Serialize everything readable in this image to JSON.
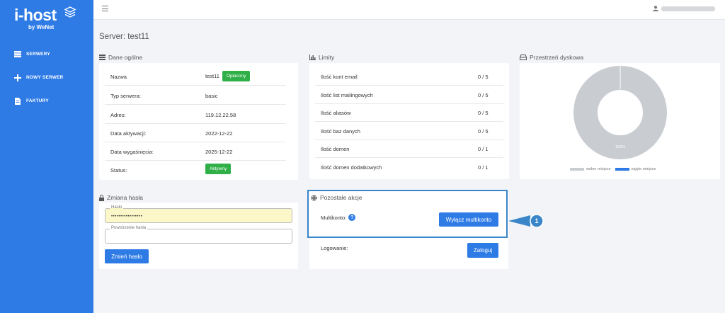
{
  "sidebar": {
    "logo": "i-host",
    "logo_sub": "by WeNet",
    "items": [
      {
        "label": "SERWERY",
        "icon": "server-icon"
      },
      {
        "label": "NOWY SERWER",
        "icon": "plus-icon"
      },
      {
        "label": "FAKTURY",
        "icon": "invoice-icon"
      }
    ]
  },
  "server_title": "Server: test11",
  "general": {
    "title": "Dane ogólne",
    "rows": [
      {
        "key": "Nazwa",
        "value": "test11",
        "badge": "Opłacony"
      },
      {
        "key": "Typ serwera:",
        "value": "basic"
      },
      {
        "key": "Adres:",
        "value": "119.12.22.58"
      },
      {
        "key": "Data aktywacji:",
        "value": "2022-12-22"
      },
      {
        "key": "Data wygaśnięcia:",
        "value": "2025-12-22"
      },
      {
        "key": "Status:",
        "value": "",
        "badge": "Aktywny"
      }
    ]
  },
  "limits": {
    "title": "Limity",
    "rows": [
      {
        "key": "Ilość kont email",
        "value": "0 / 5"
      },
      {
        "key": "Ilość list mailingowych",
        "value": "0 / 5"
      },
      {
        "key": "Ilość aliasów",
        "value": "0 / 5"
      },
      {
        "key": "Ilość baz danych",
        "value": "0 / 5"
      },
      {
        "key": "Ilość domen",
        "value": "0 / 1"
      },
      {
        "key": "Ilość domen dodatkowych",
        "value": "0 / 1"
      }
    ]
  },
  "disk": {
    "title": "Przestrzeń dyskowa",
    "percent_label": "100%",
    "free_fraction": 1.0,
    "legend_free": "wolne miejsce",
    "legend_used": "zajęte miejsce",
    "color_free": "#c9ccd1",
    "color_used": "#2e7be6"
  },
  "password": {
    "title": "Zmiana hasła",
    "field1_label": "Hasło",
    "field1_value": "•••••••••••••••••",
    "field2_label": "Powtórzenie hasła",
    "field2_value": "",
    "button": "Zmień hasło"
  },
  "actions": {
    "title": "Pozostałe akcje",
    "multikonto_label": "Multikonto:",
    "multikonto_button": "Wyłącz multikonto",
    "login_label": "Logowanie:",
    "login_button": "Zaloguj"
  },
  "callout_number": "1",
  "colors": {
    "accent": "#2e7be6",
    "success": "#2faf48",
    "highlight_border": "#3a86c8",
    "callout": "#3a86c8"
  }
}
